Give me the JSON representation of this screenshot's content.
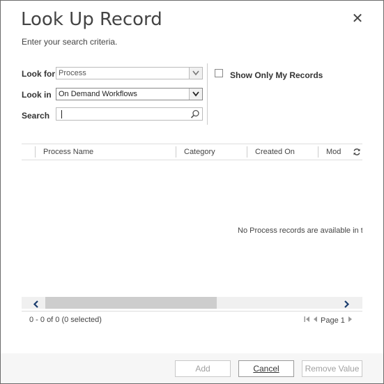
{
  "dialog": {
    "title": "Look Up Record",
    "subtitle": "Enter your search criteria.",
    "close_glyph": "✕"
  },
  "form": {
    "look_for_label": "Look for",
    "look_for_value": "Process",
    "look_in_label": "Look in",
    "look_in_value": "On Demand Workflows",
    "search_label": "Search",
    "search_value": "",
    "show_only_my_records_label": "Show Only My Records",
    "show_only_my_records_checked": false
  },
  "grid": {
    "columns": [
      "Process Name",
      "Category",
      "Created On",
      "Mod"
    ],
    "empty_message": "No Process records are available in th",
    "status": "0 - 0 of 0 (0 selected)",
    "page_label": "Page 1"
  },
  "footer": {
    "add_label": "Add",
    "cancel_label": "Cancel",
    "remove_value_label": "Remove Value"
  },
  "icons": [
    "close-icon",
    "dropdown-arrow-icon",
    "search-icon",
    "refresh-icon",
    "scroll-left-icon",
    "scroll-right-icon",
    "first-page-icon",
    "previous-page-icon",
    "next-page-icon"
  ],
  "colors": {
    "title": "#444444",
    "border": "#6b6b6b",
    "footer_bg": "#f6f6f6",
    "scroll_thumb": "#cdcdcd"
  }
}
